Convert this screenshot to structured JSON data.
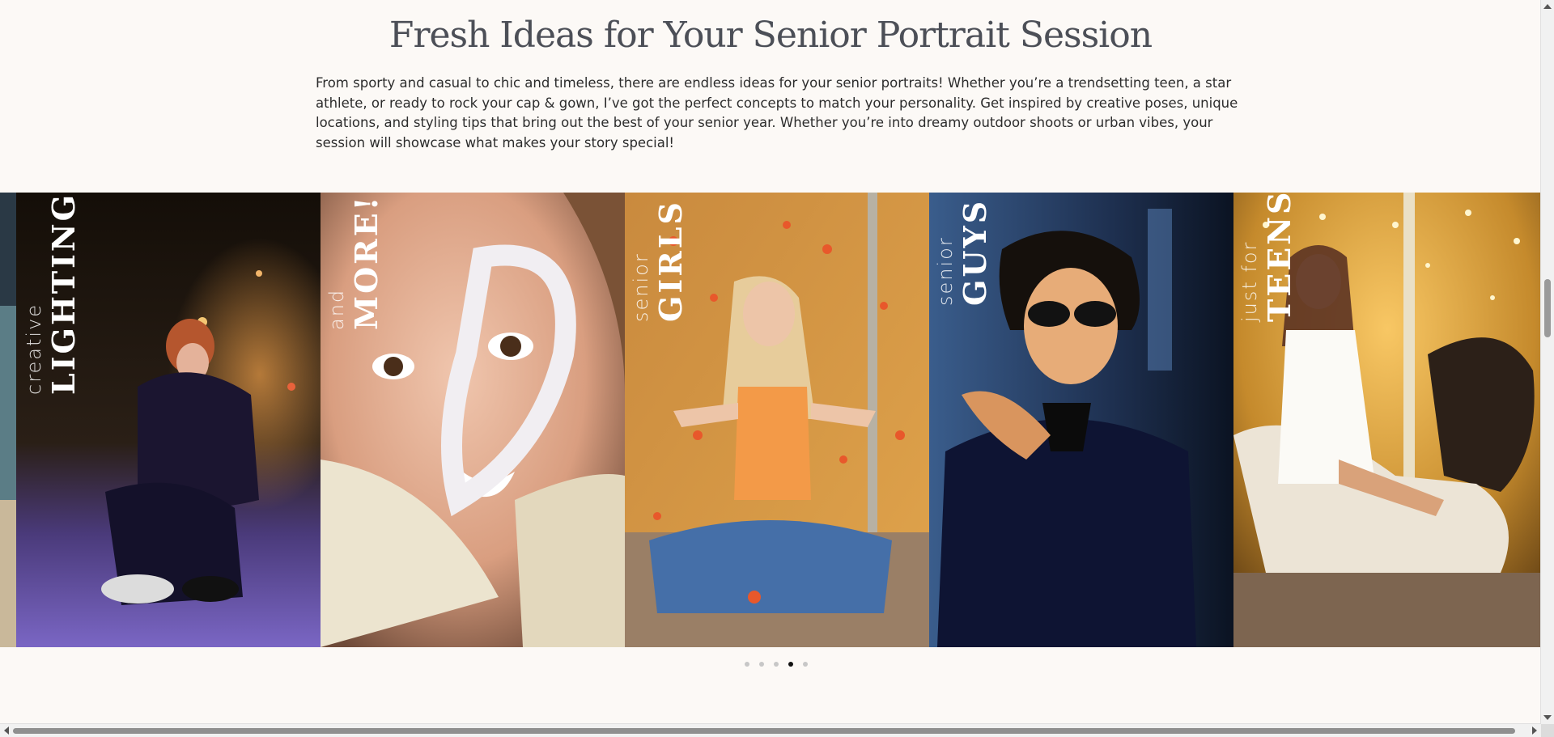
{
  "section": {
    "title": "Fresh Ideas for Your Senior Portrait Session",
    "intro": "From sporty and casual to chic and timeless, there are endless ideas for your senior portraits! Whether you’re a trendsetting teen, a star athlete, or ready to rock your cap & gown, I’ve got the perfect concepts to match your personality. Get inspired by creative poses, unique locations, and styling tips that bring out the best of your senior year. Whether you’re into dreamy outdoor shoots or urban vibes, your session will showcase what makes your story special!"
  },
  "carousel": {
    "slides": [
      {
        "small": "creative",
        "big": "LIGHTING"
      },
      {
        "small": "and",
        "big": "MORE!"
      },
      {
        "small": "senior",
        "big": "GIRLS"
      },
      {
        "small": "senior",
        "big": "GUYS"
      },
      {
        "small": "just for",
        "big": "TEENS"
      }
    ],
    "dots_count": 5,
    "active_dot": 4
  }
}
